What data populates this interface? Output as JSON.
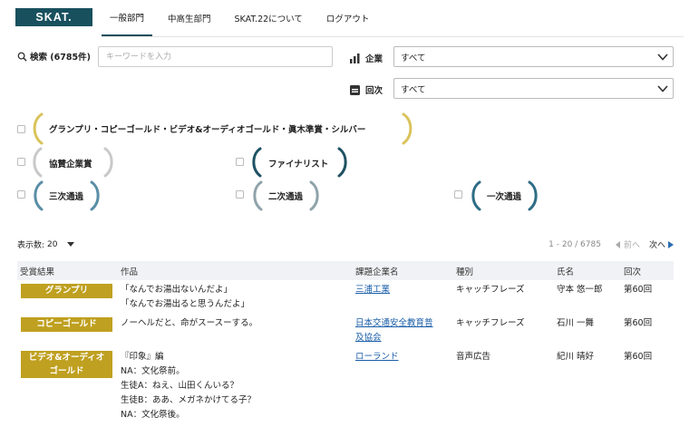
{
  "header": {
    "logo": "SKAT.",
    "tabs": [
      "一般部門",
      "中高生部門",
      "SKAT.22について",
      "ログアウト"
    ]
  },
  "search": {
    "label": "検索 (6785件)",
    "placeholder": "キーワードを入力"
  },
  "filters": {
    "company_label": "企業",
    "company_value": "すべて",
    "round_label": "回次",
    "round_value": "すべて"
  },
  "awards": {
    "grand": "グランプリ・コピーゴールド・ビデオ&オーディオゴールド・眞木準賞・シルバー",
    "sponsor": "協賛企業賞",
    "finalist": "ファイナリスト",
    "third": "三次通過",
    "second": "二次通過",
    "first": "一次通過"
  },
  "results": {
    "per_page_label": "表示数:",
    "per_page_value": "20",
    "range": "1 - 20 / 6785",
    "prev": "前へ",
    "next": "次へ"
  },
  "table": {
    "headers": [
      "受賞結果",
      "作品",
      "課題企業名",
      "種別",
      "氏名",
      "回次"
    ],
    "rows": [
      {
        "award": "グランプリ",
        "work": [
          "「なんでお湯出ないんだよ」",
          "「なんでお湯出ると思うんだよ」"
        ],
        "company": "三浦工業",
        "type": "キャッチフレーズ",
        "name": "守本 悠一郎",
        "round": "第60回"
      },
      {
        "award": "コピーゴールド",
        "work": [
          "ノーヘルだと、命がスースーする。"
        ],
        "company": [
          "日本交通安全教育普",
          "及協会"
        ],
        "type": "キャッチフレーズ",
        "name": "石川 一舞",
        "round": "第60回"
      },
      {
        "award": [
          "ビデオ&オーディオ",
          "ゴールド"
        ],
        "work": [
          "『印象』編",
          "NA：文化祭前。",
          "生徒A：ねえ、山田くんいる？",
          "生徒B：ああ、メガネかけてる子？",
          "NA：文化祭後。"
        ],
        "company": "ローランド",
        "type": "音声広告",
        "name": "紀川 晴好",
        "round": "第60回"
      }
    ]
  },
  "colors": {
    "brand": "#18505e",
    "award_badge": "#bfa020",
    "link": "#1a5ea8"
  }
}
